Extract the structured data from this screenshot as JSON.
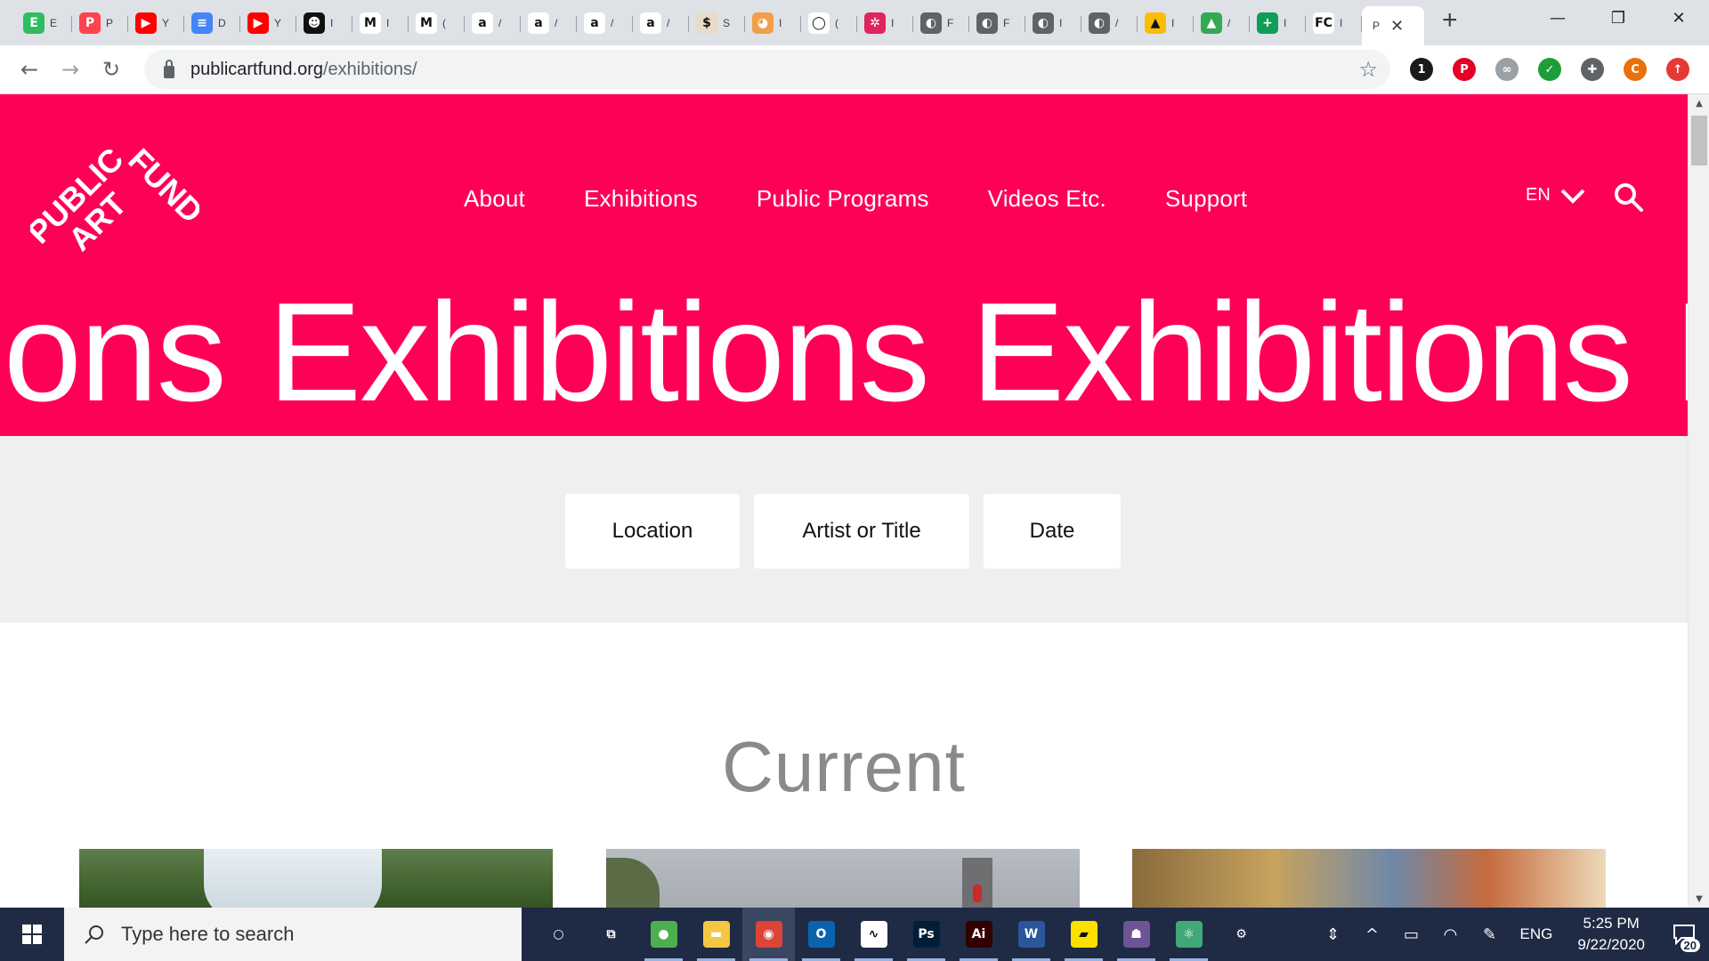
{
  "browser": {
    "tabs": [
      {
        "icon": "evernote-icon",
        "color": "#2dbe60",
        "glyph": "E",
        "label": "E"
      },
      {
        "icon": "patreon-icon",
        "color": "#ff424d",
        "glyph": "P",
        "label": "P"
      },
      {
        "icon": "youtube-icon",
        "color": "#ff0000",
        "glyph": "▶",
        "label": "Y"
      },
      {
        "icon": "google-docs-icon",
        "color": "#4285f4",
        "glyph": "≡",
        "label": "D"
      },
      {
        "icon": "youtube-icon",
        "color": "#ff0000",
        "glyph": "▶",
        "label": "Y"
      },
      {
        "icon": "dark-face-icon",
        "color": "#111111",
        "glyph": "☻",
        "label": "I"
      },
      {
        "icon": "gmail-icon",
        "color": "#ffffff",
        "glyph": "M",
        "label": "I"
      },
      {
        "icon": "gmail-icon",
        "color": "#ffffff",
        "glyph": "M",
        "label": "("
      },
      {
        "icon": "amazon-icon",
        "color": "#ffffff",
        "glyph": "a",
        "label": "/"
      },
      {
        "icon": "amazon-icon",
        "color": "#ffffff",
        "glyph": "a",
        "label": "/"
      },
      {
        "icon": "amazon-icon",
        "color": "#ffffff",
        "glyph": "a",
        "label": "/"
      },
      {
        "icon": "amazon-icon",
        "color": "#ffffff",
        "glyph": "a",
        "label": "/"
      },
      {
        "icon": "dollar-icon",
        "color": "#e8dcc6",
        "glyph": "$",
        "label": "S"
      },
      {
        "icon": "shiba-icon",
        "color": "#f0a04b",
        "glyph": "◕",
        "label": "I"
      },
      {
        "icon": "ring-icon",
        "color": "#ffffff",
        "glyph": "◯",
        "label": "("
      },
      {
        "icon": "wheel-icon",
        "color": "#e0245e",
        "glyph": "✲",
        "label": "I"
      },
      {
        "icon": "globe-icon",
        "color": "#5f6368",
        "glyph": "◐",
        "label": "F"
      },
      {
        "icon": "globe-icon",
        "color": "#5f6368",
        "glyph": "◐",
        "label": "F"
      },
      {
        "icon": "globe-icon",
        "color": "#5f6368",
        "glyph": "◐",
        "label": "I"
      },
      {
        "icon": "globe-icon",
        "color": "#5f6368",
        "glyph": "◐",
        "label": "/"
      },
      {
        "icon": "google-drive-icon",
        "color": "#fbbc04",
        "glyph": "▲",
        "label": "I"
      },
      {
        "icon": "google-drive-icon",
        "color": "#34a853",
        "glyph": "▲",
        "label": "/"
      },
      {
        "icon": "plus-square-icon",
        "color": "#0f9d58",
        "glyph": "+",
        "label": "I"
      },
      {
        "icon": "fc-icon",
        "color": "#ffffff",
        "glyph": "FC",
        "label": "I"
      }
    ],
    "active_tab": {
      "label": "P",
      "close_glyph": "✕"
    },
    "new_tab_glyph": "+",
    "window_controls": {
      "minimize": "—",
      "restore": "❐",
      "close": "✕"
    },
    "url_host": "publicartfund.org",
    "url_path": "/exhibitions/",
    "back_glyph": "←",
    "forward_glyph": "→",
    "reload_glyph": "↻",
    "star_glyph": "☆",
    "extensions": [
      {
        "icon": "onepassword-icon",
        "color": "#1a1a1a",
        "glyph": "1"
      },
      {
        "icon": "pinterest-icon",
        "color": "#e60023",
        "glyph": "P"
      },
      {
        "icon": "link-icon",
        "color": "#9aa0a6",
        "glyph": "∞"
      },
      {
        "icon": "checkmark-icon",
        "color": "#1e9e3a",
        "glyph": "✓"
      },
      {
        "icon": "puzzle-icon",
        "color": "#5f6368",
        "glyph": "✚"
      },
      {
        "icon": "profile-avatar-icon",
        "color": "#e8710a",
        "glyph": "C"
      },
      {
        "icon": "upload-icon",
        "color": "#e53935",
        "glyph": "↑"
      }
    ]
  },
  "site": {
    "brand_color": "#ff0057",
    "logo": {
      "line1": "PUBLIC",
      "line2": "ART",
      "line3": "FUND"
    },
    "nav": [
      {
        "label": "About"
      },
      {
        "label": "Exhibitions"
      },
      {
        "label": "Public Programs"
      },
      {
        "label": "Videos Etc."
      },
      {
        "label": "Support"
      }
    ],
    "language": "EN",
    "marquee_words": [
      "ons",
      "Exhibitions",
      "Exhibitions",
      "Ex"
    ],
    "filters": [
      {
        "label": "Location"
      },
      {
        "label": "Artist or Title"
      },
      {
        "label": "Date"
      }
    ],
    "section_title": "Current"
  },
  "taskbar": {
    "search_placeholder": "Type here to search",
    "apps": [
      {
        "icon": "cortana-icon",
        "color": "#1f2a44",
        "glyph": "○"
      },
      {
        "icon": "task-view-icon",
        "color": "#1f2a44",
        "glyph": "⧉"
      },
      {
        "icon": "greenshot-icon",
        "color": "#4caf50",
        "glyph": "●"
      },
      {
        "icon": "file-explorer-icon",
        "color": "#f2c744",
        "glyph": "▬"
      },
      {
        "icon": "chrome-icon",
        "color": "#db4437",
        "glyph": "◉"
      },
      {
        "icon": "outlook-icon",
        "color": "#0a64ad",
        "glyph": "O"
      },
      {
        "icon": "clip-studio-icon",
        "color": "#ffffff",
        "glyph": "∿"
      },
      {
        "icon": "photoshop-icon",
        "color": "#001e36",
        "glyph": "Ps"
      },
      {
        "icon": "illustrator-icon",
        "color": "#330000",
        "glyph": "Ai"
      },
      {
        "icon": "word-icon",
        "color": "#2b579a",
        "glyph": "W"
      },
      {
        "icon": "sticky-notes-icon",
        "color": "#fce100",
        "glyph": "▰"
      },
      {
        "icon": "github-icon",
        "color": "#6e5494",
        "glyph": "☗"
      },
      {
        "icon": "atom-icon",
        "color": "#40a977",
        "glyph": "⚛"
      },
      {
        "icon": "settings-icon",
        "color": "#1f2a44",
        "glyph": "⚙"
      }
    ],
    "tray_language": "ENG",
    "time": "5:25 PM",
    "date": "9/22/2020",
    "notification_count": "20"
  }
}
